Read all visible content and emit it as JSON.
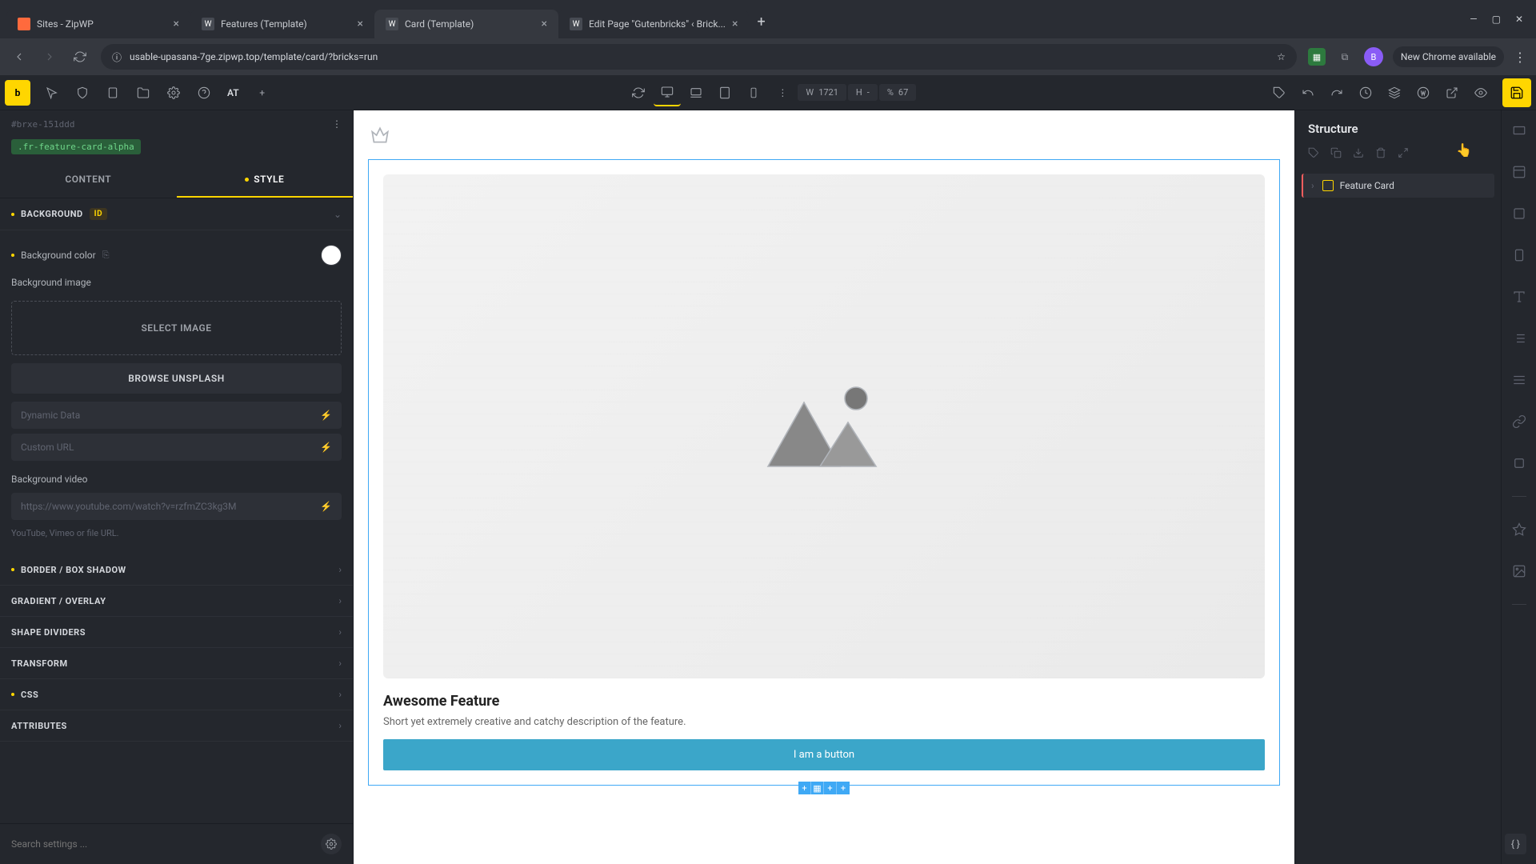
{
  "browser": {
    "tabs": [
      {
        "title": "Sites - ZipWP",
        "active": false
      },
      {
        "title": "Features (Template)",
        "active": false
      },
      {
        "title": "Card (Template)",
        "active": true
      },
      {
        "title": "Edit Page \"Gutenbricks\" ‹ Brick...",
        "active": false
      }
    ],
    "url": "usable-upasana-7ge.zipwp.top/template/card/?bricks=run",
    "new_chrome": "New Chrome available",
    "profile_initial": "B"
  },
  "toolbar": {
    "at_label": "AT",
    "width_value": "1721",
    "height_value": "-",
    "w_prefix": "W",
    "h_prefix": "H",
    "percent_prefix": "%",
    "percent_value": "67"
  },
  "left_panel": {
    "element_id": "#brxe-151ddd",
    "class_name": ".fr-feature-card-alpha",
    "tab_content": "CONTENT",
    "tab_style": "STYLE",
    "sections": {
      "background": {
        "title": "BACKGROUND",
        "badge": "ID",
        "bg_color_label": "Background color",
        "bg_image_label": "Background image",
        "select_image": "SELECT IMAGE",
        "browse_unsplash": "BROWSE UNSPLASH",
        "dynamic_data_placeholder": "Dynamic Data",
        "custom_url_placeholder": "Custom URL",
        "bg_video_label": "Background video",
        "bg_video_placeholder": "https://www.youtube.com/watch?v=rzfmZC3kg3M",
        "bg_video_help": "YouTube, Vimeo or file URL."
      },
      "border": "BORDER / BOX SHADOW",
      "gradient": "GRADIENT / OVERLAY",
      "shape": "SHAPE DIVIDERS",
      "transform": "TRANSFORM",
      "css": "CSS",
      "attributes": "ATTRIBUTES"
    },
    "search_placeholder": "Search settings ..."
  },
  "canvas": {
    "card_title": "Awesome Feature",
    "card_desc": "Short yet extremely creative and catchy description of the feature.",
    "card_button": "I am a button"
  },
  "structure": {
    "title": "Structure",
    "item1": "Feature Card"
  },
  "css_badge": "{ }"
}
